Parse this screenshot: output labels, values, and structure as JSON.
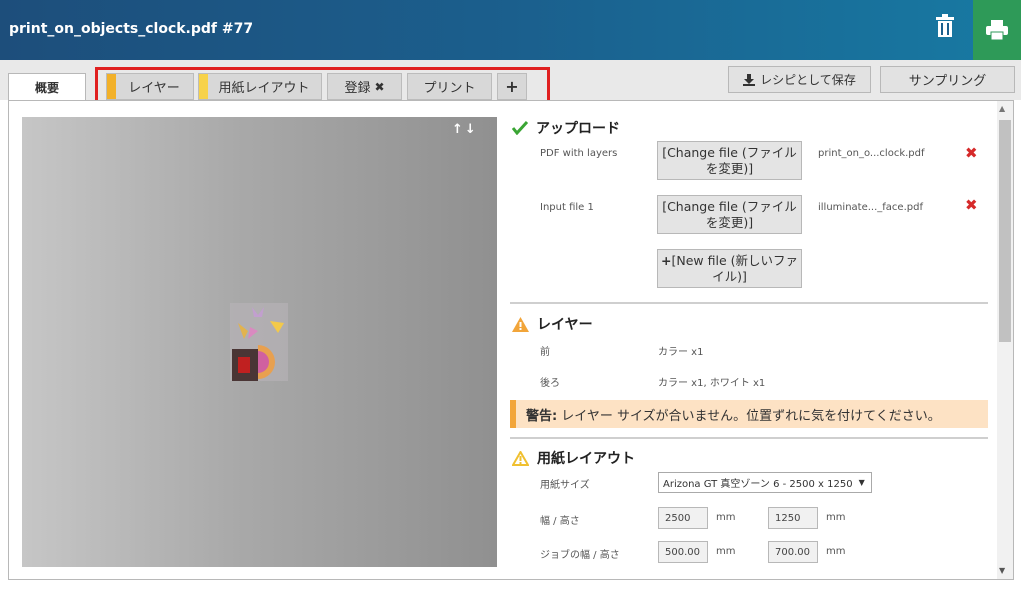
{
  "window": {
    "title": "print_on_objects_clock.pdf #77"
  },
  "header_actions": {
    "delete_icon": "trash-icon",
    "print_icon": "printer-icon"
  },
  "tabs": {
    "overview": "概要",
    "layers": "レイヤー",
    "paper_layout": "用紙レイアウト",
    "register": "登録",
    "register_close": "✖",
    "print": "プリント",
    "add": "+"
  },
  "toolbar": {
    "save_recipe": "レシピとして保存",
    "sampling": "サンプリング"
  },
  "preview": {
    "arrows": "↑↓"
  },
  "upload": {
    "title": "アップロード",
    "pdf_label": "PDF with layers",
    "pdf_button": "[Change file (ファイルを変更)]",
    "pdf_file": "print_on_o...clock.pdf",
    "input_label": "Input file 1",
    "input_button": "[Change file (ファイルを変更)]",
    "input_file": "illuminate..._face.pdf",
    "new_file_button": "[New file (新しいファイル)]"
  },
  "layers_section": {
    "title": "レイヤー",
    "front_label": "前",
    "front_value": "カラー x1",
    "back_label": "後ろ",
    "back_value": "カラー x1, ホワイト x1",
    "warning_bold": "警告:",
    "warning_text": "レイヤー サイズが合いません。位置ずれに気を付けてください。"
  },
  "paper_section": {
    "title": "用紙レイアウト",
    "size_label": "用紙サイズ",
    "size_value": "Arizona GT 真空ゾーン 6 - 2500 x 1250",
    "wh_label": "幅 / 高さ",
    "width": "2500",
    "height": "1250",
    "unit": "mm",
    "job_label": "ジョブの幅 / 高さ",
    "job_width": "500.00",
    "job_height": "700.00"
  },
  "colors": {
    "accent_orange": "#f2b12a",
    "accent_yellow": "#f7d24a",
    "print_green": "#2e9a58",
    "highlight_red": "#e02020"
  }
}
